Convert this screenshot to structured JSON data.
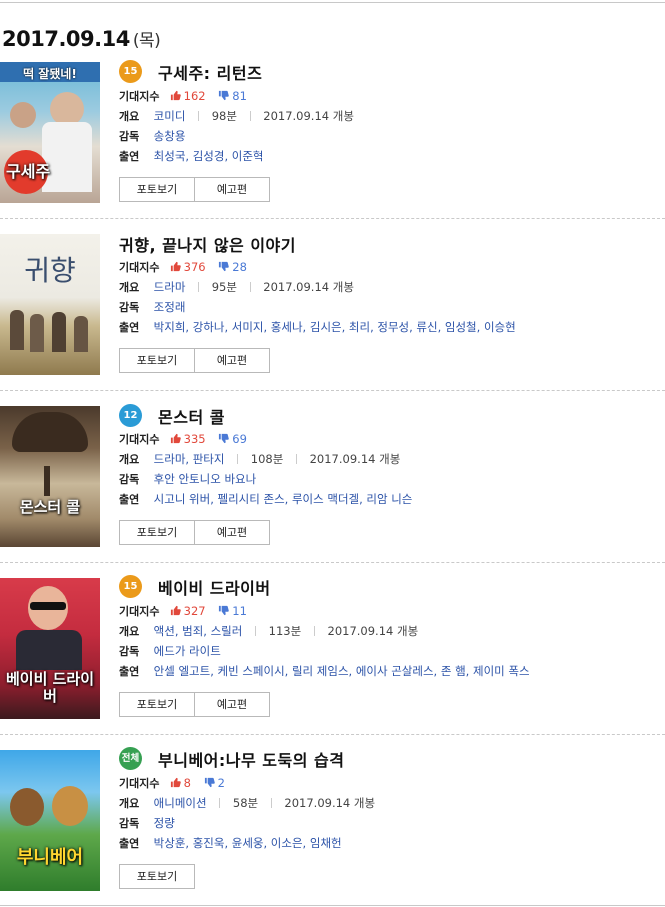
{
  "date_header": {
    "date": "2017.09.14",
    "weekday": "(목)"
  },
  "labels": {
    "expect": "기대지수",
    "genre": "개요",
    "director": "감독",
    "cast": "출연"
  },
  "colors": {
    "like": "#e1483b",
    "dislike": "#4a79d5",
    "rating_15": "#eb9a1a",
    "rating_12": "#2a9bd6",
    "rating_all": "#36a052",
    "link": "#2c53a8"
  },
  "icons": {
    "like": "thumbs-up-icon",
    "dislike": "thumbs-down-icon"
  },
  "movies": [
    {
      "rating": "15",
      "title": "구세주: 리턴즈",
      "likes": "162",
      "dislikes": "81",
      "genre": "코미디",
      "runtime": "98분",
      "release": "2017.09.14 개봉",
      "director": "송창용",
      "cast": "최성국, 김성경, 이준혁",
      "poster_text": "구세주",
      "poster_tag": "떡 잘됐네!",
      "buttons": [
        "포토보기",
        "예고편"
      ]
    },
    {
      "rating": "",
      "title": "귀향, 끝나지 않은 이야기",
      "likes": "376",
      "dislikes": "28",
      "genre": "드라마",
      "runtime": "95분",
      "release": "2017.09.14 개봉",
      "director": "조정래",
      "cast": "박지희, 강하나, 서미지, 홍세나, 김시은, 최리, 정무성, 류신, 임성철, 이승현",
      "poster_text": "귀향",
      "poster_tag": "",
      "buttons": [
        "포토보기",
        "예고편"
      ]
    },
    {
      "rating": "12",
      "title": "몬스터 콜",
      "likes": "335",
      "dislikes": "69",
      "genre": "드라마, 판타지",
      "runtime": "108분",
      "release": "2017.09.14 개봉",
      "director": "후안 안토니오 바요나",
      "cast": "시고니 위버, 펠리시티 존스, 루이스 맥더겔, 리암 니슨",
      "poster_text": "몬스터 콜",
      "poster_tag": "",
      "buttons": [
        "포토보기",
        "예고편"
      ]
    },
    {
      "rating": "15",
      "title": "베이비 드라이버",
      "likes": "327",
      "dislikes": "11",
      "genre": "액션, 범죄, 스릴러",
      "runtime": "113분",
      "release": "2017.09.14 개봉",
      "director": "에드가 라이트",
      "cast": "안셀 엘고트, 케빈 스페이시, 릴리 제임스, 에이사 곤살레스, 존 햄, 제이미 폭스",
      "poster_text": "베이비 드라이버",
      "poster_tag": "",
      "buttons": [
        "포토보기",
        "예고편"
      ]
    },
    {
      "rating": "전체",
      "title": "부니베어:나무 도둑의 습격",
      "likes": "8",
      "dislikes": "2",
      "genre": "애니메이션",
      "runtime": "58분",
      "release": "2017.09.14 개봉",
      "director": "정량",
      "cast": "박상훈, 홍진욱, 윤세웅, 이소은, 임채헌",
      "poster_text": "부니베어",
      "poster_tag": "",
      "buttons": [
        "포토보기"
      ]
    }
  ]
}
